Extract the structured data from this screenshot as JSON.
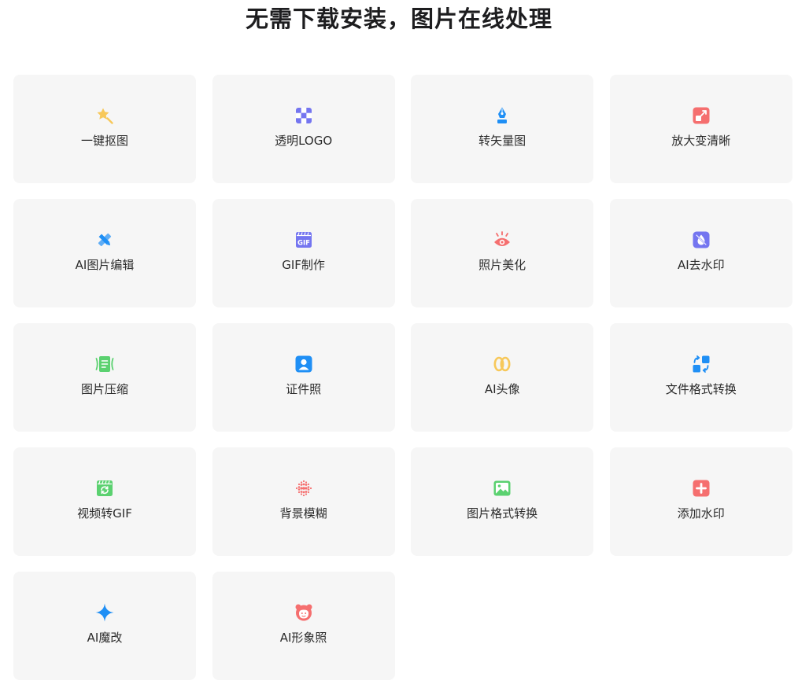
{
  "page": {
    "title": "无需下载安装，图片在线处理"
  },
  "colors": {
    "card_background": "#f6f6f6",
    "yellow": "#f7c85a",
    "purple": "#7475f0",
    "blue": "#1f8ff5",
    "coral": "#f56f6f",
    "green": "#5bd170"
  },
  "tools": [
    {
      "label": "一键抠图",
      "icon": "magic-wand-icon"
    },
    {
      "label": "透明LOGO",
      "icon": "checkerboard-icon"
    },
    {
      "label": "转矢量图",
      "icon": "pen-tool-icon"
    },
    {
      "label": "放大变清晰",
      "icon": "enlarge-icon"
    },
    {
      "label": "AI图片编辑",
      "icon": "pencil-ruler-icon"
    },
    {
      "label": "GIF制作",
      "icon": "gif-clapper-icon",
      "icon_text": "GIF"
    },
    {
      "label": "照片美化",
      "icon": "eye-icon"
    },
    {
      "label": "AI去水印",
      "icon": "no-drop-icon"
    },
    {
      "label": "图片压缩",
      "icon": "compress-icon"
    },
    {
      "label": "证件照",
      "icon": "id-photo-icon"
    },
    {
      "label": "AI头像",
      "icon": "avatar-rings-icon"
    },
    {
      "label": "文件格式转换",
      "icon": "file-convert-icon"
    },
    {
      "label": "视频转GIF",
      "icon": "video-refresh-icon"
    },
    {
      "label": "背景模糊",
      "icon": "blur-dots-icon"
    },
    {
      "label": "图片格式转换",
      "icon": "image-icon"
    },
    {
      "label": "添加水印",
      "icon": "plus-square-icon"
    },
    {
      "label": "AI魔改",
      "icon": "sparkle-icon"
    },
    {
      "label": "AI形象照",
      "icon": "portrait-face-icon"
    }
  ]
}
